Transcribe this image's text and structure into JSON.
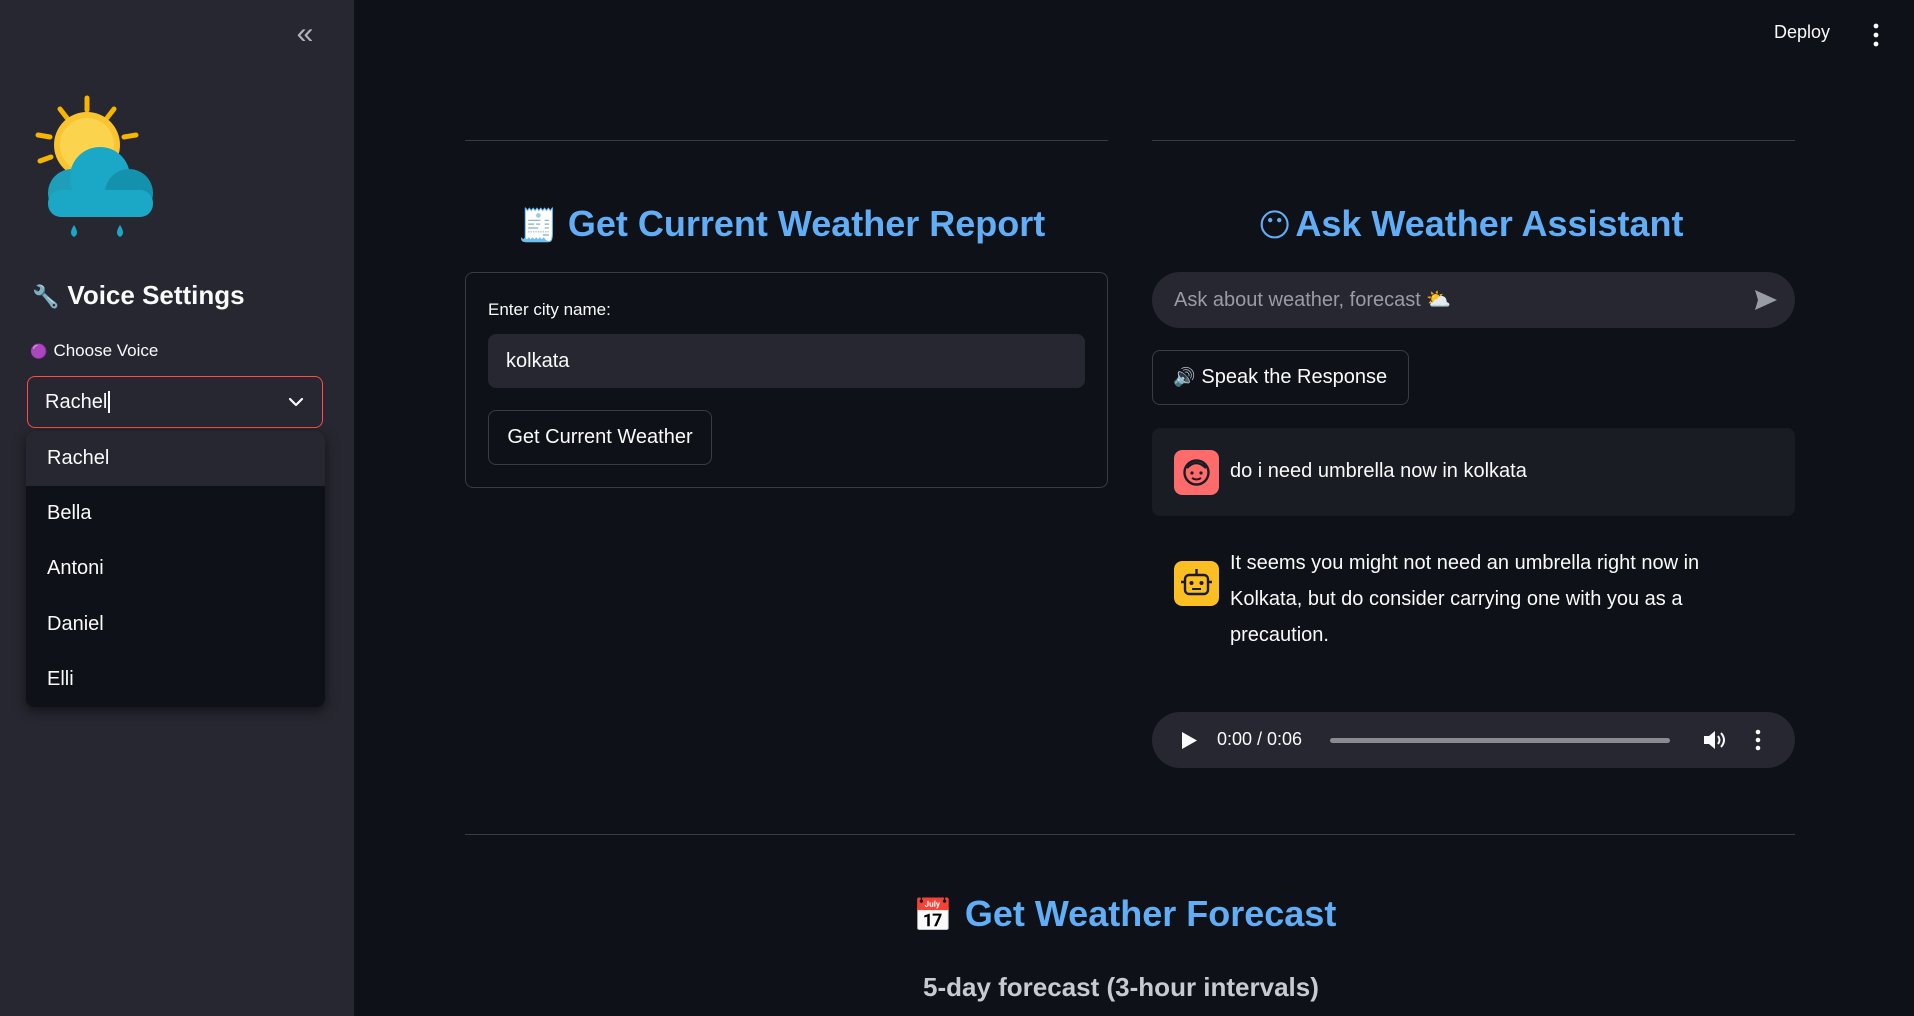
{
  "topbar": {
    "deploy_label": "Deploy"
  },
  "sidebar": {
    "heading_icon": "🔧",
    "heading": "Voice Settings",
    "choose_voice_icon": "🟣",
    "choose_voice_label": "Choose Voice",
    "selected_voice": "Rachel",
    "voice_options": [
      "Rachel",
      "Bella",
      "Antoni",
      "Daniel",
      "Elli"
    ],
    "accent_color": "#ff4b4b"
  },
  "current_weather": {
    "title_icon": "🧾",
    "title": "Get Current Weather Report",
    "city_label": "Enter city name:",
    "city_value": "kolkata",
    "button_label": "Get Current Weather"
  },
  "assistant": {
    "title_icon": "😶",
    "title": "Ask Weather Assistant",
    "chat_placeholder": "Ask about weather, forecast ⛅",
    "speak_icon": "🔊",
    "speak_label": "Speak the Response",
    "messages": [
      {
        "role": "user",
        "text": "do i need umbrella now in kolkata"
      },
      {
        "role": "assistant",
        "text": "It seems you might not need an umbrella right now in Kolkata, but do consider carrying one with you as a precaution."
      }
    ],
    "audio": {
      "time_display": "0:00 / 0:06",
      "progress": 0
    }
  },
  "forecast": {
    "title_icon": "📅",
    "title": "Get Weather Forecast",
    "subtitle": "5-day forecast (3-hour intervals)"
  }
}
